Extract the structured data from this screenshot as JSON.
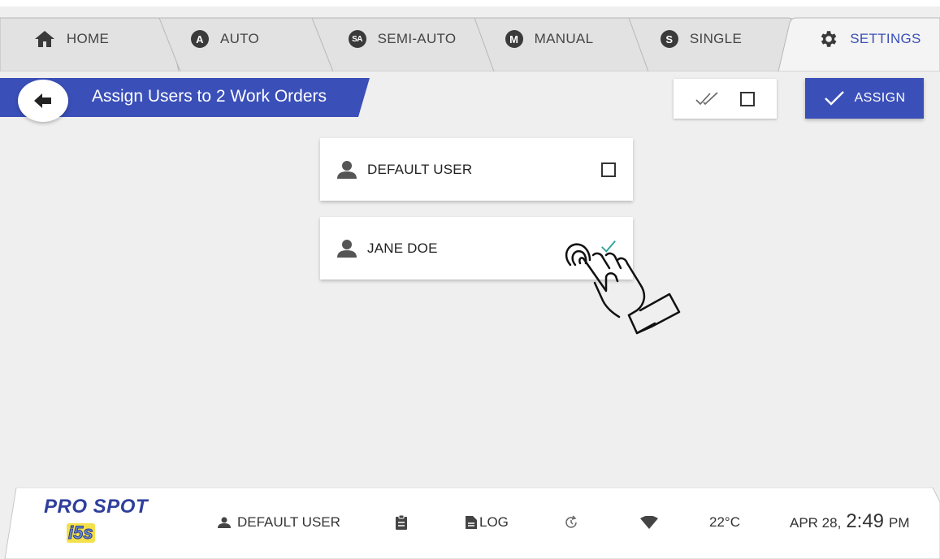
{
  "tabs": [
    {
      "label": "HOME",
      "icon": "home-icon",
      "active": false
    },
    {
      "label": "AUTO",
      "badge": "A",
      "active": false
    },
    {
      "label": "SEMI-AUTO",
      "badge": "SA",
      "active": false
    },
    {
      "label": "MANUAL",
      "badge": "M",
      "active": false
    },
    {
      "label": "SINGLE",
      "badge": "S",
      "active": false
    },
    {
      "label": "SETTINGS",
      "icon": "gear-icon",
      "active": true
    }
  ],
  "header": {
    "title": "Assign Users to 2 Work Orders",
    "assign_label": "ASSIGN"
  },
  "users": [
    {
      "name": "DEFAULT USER",
      "checked": false
    },
    {
      "name": "JANE DOE",
      "checked": true
    }
  ],
  "footer": {
    "brand": "PRO SPOT",
    "brand_sub": "i5s",
    "user": "DEFAULT USER",
    "log_label": "LOG",
    "temperature": "22°C",
    "date": "APR 28,",
    "time": "2:49",
    "ampm": "PM"
  },
  "colors": {
    "accent": "#3a4fb8",
    "check_teal": "#2aa198",
    "background": "#efefef"
  }
}
